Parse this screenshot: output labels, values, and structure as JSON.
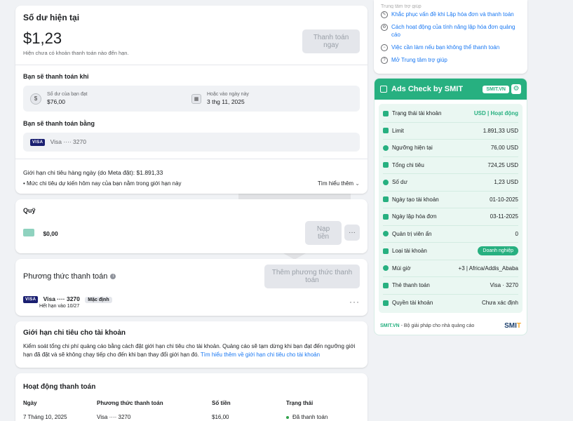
{
  "balance": {
    "title": "Số dư hiện tại",
    "amount": "$1,23",
    "note": "Hiện chưa có khoản thanh toán nào đến hạn.",
    "pay_now": "Thanh toán ngay"
  },
  "pay_when": {
    "title": "Bạn sẽ thanh toán khi",
    "threshold_label": "Số dư của bạn đạt",
    "threshold_value": "$76,00",
    "date_label": "Hoặc vào ngày này",
    "date_value": "3 thg 11, 2025"
  },
  "pay_with": {
    "title": "Bạn sẽ thanh toán bằng",
    "visa_logo": "VISA",
    "card": "Visa ···· 3270"
  },
  "daily_limit": {
    "text": "Giới hạn chi tiêu hàng ngày (do Meta đặt): $1.891,33",
    "bullet": "Mức chi tiêu dự kiến hôm nay của bạn nằm trong giới hạn này",
    "learn_more": "Tìm hiểu thêm"
  },
  "fund": {
    "title": "Quỹ",
    "amount": "$0,00",
    "button": "Nạp tiền"
  },
  "payment_methods": {
    "title": "Phương thức thanh toán",
    "add_button": "Thêm phương thức thanh toán",
    "visa_logo": "VISA",
    "card": "Visa ···· 3270",
    "default_tag": "Mặc định",
    "expiry": "Hết hạn vào 10/27"
  },
  "account_limit": {
    "title": "Giới hạn chi tiêu cho tài khoản",
    "description": "Kiểm soát tổng chi phí quảng cáo bằng cách đặt giới hạn chi tiêu cho tài khoản. Quảng cáo sẽ tạm dừng khi bạn đạt đến ngưỡng giới hạn đã đặt và sẽ không chạy tiếp cho đến khi bạn thay đổi giới hạn đó.",
    "link": "Tìm hiểu thêm về giới hạn chi tiêu cho tài khoản"
  },
  "activity": {
    "title": "Hoạt động thanh toán",
    "headers": [
      "Ngày",
      "Phương thức thanh toán",
      "Số tiền",
      "Trạng thái"
    ],
    "rows": [
      [
        "7 Tháng 10, 2025",
        "Visa ···· 3270",
        "$16,00",
        "Đã thanh toán"
      ]
    ]
  },
  "help": {
    "top_cut": "Trung tâm trợ giúp",
    "items": [
      "Khắc phục vấn đề khi Lập hóa đơn và thanh toán",
      "Cách hoạt động của tính năng lập hóa đơn quảng cáo",
      "Việc cần làm nếu bạn không thể thanh toán",
      "Mở Trung tâm trợ giúp"
    ]
  },
  "smit": {
    "title": "Ads Check by SMIT",
    "badge": "SMIT.VN",
    "rows": [
      {
        "label": "Trạng thái tài khoản",
        "value": "USD | Hoạt động"
      },
      {
        "label": "Limit",
        "value": "1.891,33 USD"
      },
      {
        "label": "Ngưỡng hiện tại",
        "value": "76,00 USD"
      },
      {
        "label": "Tổng chi tiêu",
        "value": "724,25 USD"
      },
      {
        "label": "Số dư",
        "value": "1,23 USD"
      },
      {
        "label": "Ngày tạo tài khoản",
        "value": "01-10-2025"
      },
      {
        "label": "Ngày lập hóa đơn",
        "value": "03-11-2025"
      },
      {
        "label": "Quản trị viên ẩn",
        "value": "0"
      },
      {
        "label": "Loại tài khoản",
        "value": "Doanh nghiệp"
      },
      {
        "label": "Múi giờ",
        "value": "+3 | Africa/Addis_Ababa"
      },
      {
        "label": "Thẻ thanh toán",
        "value": "Visa · 3270"
      },
      {
        "label": "Quyền tài khoản",
        "value": "Chưa xác định"
      }
    ],
    "footer_brand": "SMIT.VN",
    "footer_text": "- Bộ giải pháp cho nhà quảng cáo",
    "logo_main": "SMI",
    "logo_accent": "T",
    "accent": "#27b080"
  }
}
